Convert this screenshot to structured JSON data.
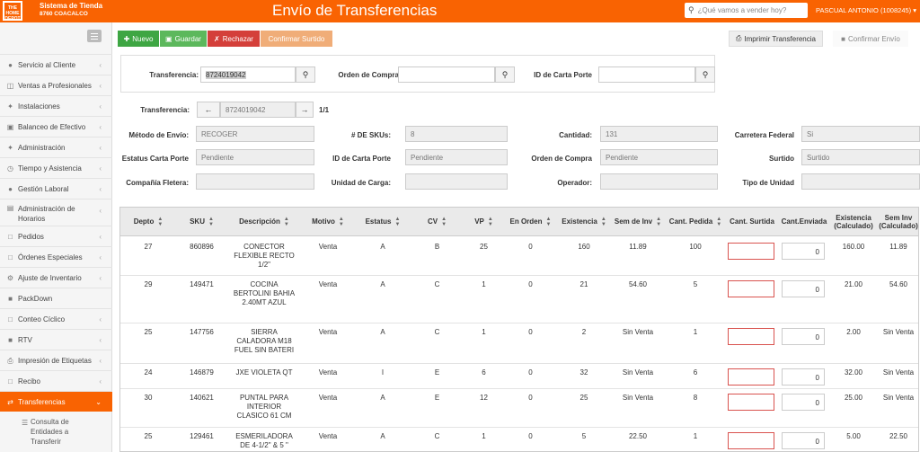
{
  "header": {
    "logo_text": "THE HOME DEPOT",
    "store_name": "Sistema de Tienda",
    "store_id": "8760 COACALCO",
    "title": "Envío de Transferencias",
    "search_placeholder": "¿Qué vamos a vender hoy?",
    "user": "PASCUAL ANTONIO (1008245)"
  },
  "sidebar": {
    "items": [
      {
        "label": "Servicio al Cliente",
        "icon": "person-icon"
      },
      {
        "label": "Ventas a Profesionales",
        "icon": "cart-icon"
      },
      {
        "label": "Instalaciones",
        "icon": "wrench-icon"
      },
      {
        "label": "Balanceo de Efectivo",
        "icon": "cash-icon"
      },
      {
        "label": "Administración",
        "icon": "wrench-icon"
      },
      {
        "label": "Tiempo y Asistencia",
        "icon": "clock-icon"
      },
      {
        "label": "Gestión Laboral",
        "icon": "users-icon"
      },
      {
        "label": "Administración de Horarios",
        "icon": "calendar-icon"
      },
      {
        "label": "Pedidos",
        "icon": "file-icon"
      },
      {
        "label": "Órdenes Especiales",
        "icon": "file-icon"
      },
      {
        "label": "Ajuste de Inventario",
        "icon": "gear-icon"
      },
      {
        "label": "PackDown",
        "icon": "box-icon"
      },
      {
        "label": "Conteo Cíclico",
        "icon": "file-icon"
      },
      {
        "label": "RTV",
        "icon": "truck-icon"
      },
      {
        "label": "Impresión de Etiquetas",
        "icon": "print-icon"
      },
      {
        "label": "Recibo",
        "icon": "file-icon"
      },
      {
        "label": "Transferencias",
        "icon": "transfer-icon"
      }
    ],
    "sub_item": "Consulta de Entidades a Transferir"
  },
  "toolbar": {
    "nuevo": "Nuevo",
    "guardar": "Guardar",
    "rechazar": "Rechazar",
    "confirmar_surtido": "Confirmar Surtido",
    "imprimir": "Imprimir Transferencia",
    "confirmar_envio": "Confirmar Envío"
  },
  "search_panel": {
    "transferencia_label": "Transferencia:",
    "transferencia_value": "8724019042",
    "orden_compra_label": "Orden de Compra",
    "carta_porte_label": "ID de Carta Porte"
  },
  "detail": {
    "transferencia_label": "Transferencia:",
    "transferencia_value": "8724019042",
    "pager": "1/1",
    "metodo_label": "Método de Envío:",
    "metodo_value": "RECOGER",
    "skus_label": "# DE SKUs:",
    "skus_value": "8",
    "cantidad_label": "Cantidad:",
    "cantidad_value": "131",
    "carretera_label": "Carretera Federal",
    "carretera_value": "Si",
    "estatus_label": "Estatus Carta Porte",
    "estatus_value": "Pendiente",
    "idcarta_label": "ID de Carta Porte",
    "idcarta_value": "Pendiente",
    "orden_label": "Orden de Compra",
    "orden_value": "Pendiente",
    "surtido_label": "Surtido",
    "surtido_value": "Surtido",
    "fletera_label": "Compañía Fletera:",
    "unidad_label": "Unidad de Carga:",
    "operador_label": "Operador:",
    "tipo_label": "Tipo de Unidad"
  },
  "table": {
    "headers": [
      "Depto",
      "SKU",
      "Descripción",
      "Motivo",
      "Estatus",
      "CV",
      "VP",
      "En Orden",
      "Existencia",
      "Sem de Inv",
      "Cant. Pedida",
      "Cant. Surtida",
      "Cant.Enviada",
      "Existencia (Calculado)",
      "Sem Inv (Calculado)"
    ],
    "rows": [
      {
        "depto": "27",
        "sku": "860896",
        "desc": "CONECTOR FLEXIBLE RECTO 1/2\"",
        "motivo": "Venta",
        "estatus": "A",
        "cv": "B",
        "vp": "25",
        "orden": "0",
        "exist": "160",
        "sem": "11.89",
        "pedida": "100",
        "enviada": "0",
        "exist_calc": "160.00",
        "sem_calc": "11.89"
      },
      {
        "depto": "29",
        "sku": "149471",
        "desc": "COCINA BERTOLINI BAHIA 2.40MT AZUL",
        "motivo": "Venta",
        "estatus": "A",
        "cv": "C",
        "vp": "1",
        "orden": "0",
        "exist": "21",
        "sem": "54.60",
        "pedida": "5",
        "enviada": "0",
        "exist_calc": "21.00",
        "sem_calc": "54.60"
      },
      {
        "depto": "25",
        "sku": "147756",
        "desc": "SIERRA CALADORA M18 FUEL SIN BATERI",
        "motivo": "Venta",
        "estatus": "A",
        "cv": "C",
        "vp": "1",
        "orden": "0",
        "exist": "2",
        "sem": "Sin Venta",
        "pedida": "1",
        "enviada": "0",
        "exist_calc": "2.00",
        "sem_calc": "Sin Venta"
      },
      {
        "depto": "24",
        "sku": "146879",
        "desc": "JXE VIOLETA QT",
        "motivo": "Venta",
        "estatus": "I",
        "cv": "E",
        "vp": "6",
        "orden": "0",
        "exist": "32",
        "sem": "Sin Venta",
        "pedida": "6",
        "enviada": "0",
        "exist_calc": "32.00",
        "sem_calc": "Sin Venta"
      },
      {
        "depto": "30",
        "sku": "140621",
        "desc": "PUNTAL PARA INTERIOR CLASICO 61 CM",
        "motivo": "Venta",
        "estatus": "A",
        "cv": "E",
        "vp": "12",
        "orden": "0",
        "exist": "25",
        "sem": "Sin Venta",
        "pedida": "8",
        "enviada": "0",
        "exist_calc": "25.00",
        "sem_calc": "Sin Venta"
      },
      {
        "depto": "25",
        "sku": "129461",
        "desc": "ESMERILADORA DE 4-1/2\" & 5 \"",
        "motivo": "Venta",
        "estatus": "A",
        "cv": "C",
        "vp": "1",
        "orden": "0",
        "exist": "5",
        "sem": "22.50",
        "pedida": "1",
        "enviada": "0",
        "exist_calc": "5.00",
        "sem_calc": "22.50"
      }
    ]
  }
}
